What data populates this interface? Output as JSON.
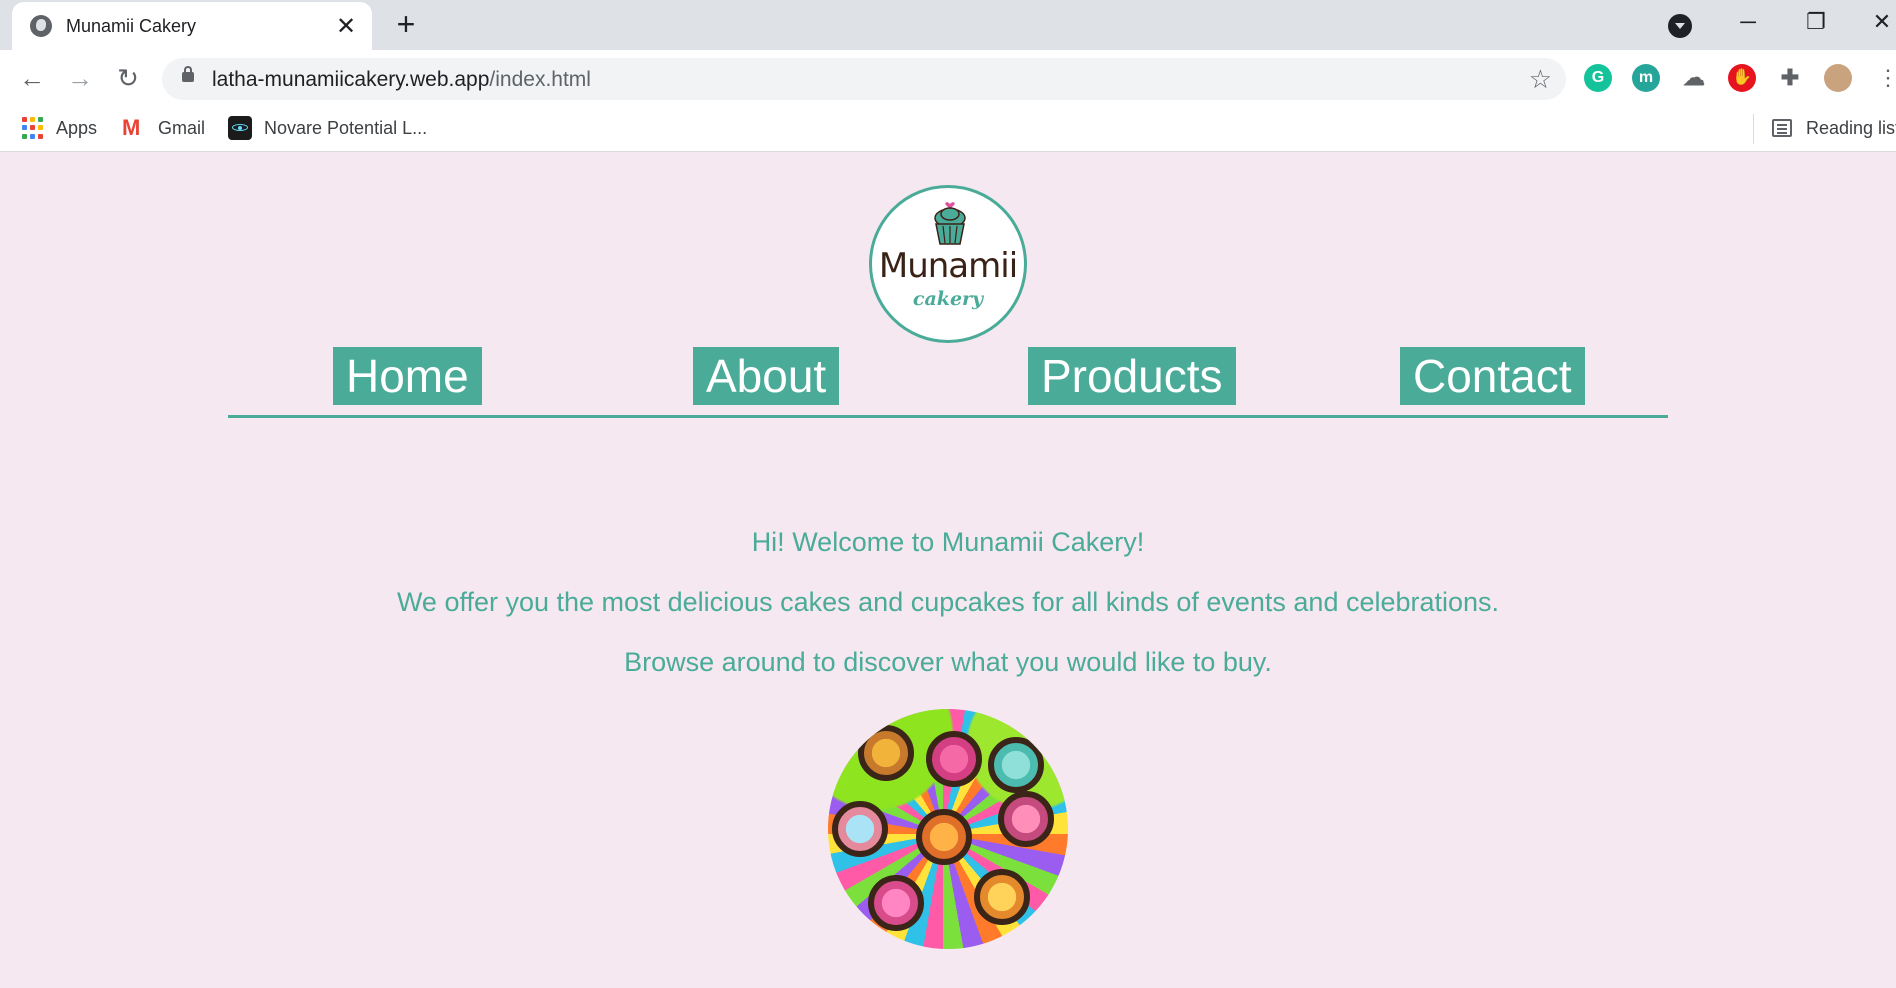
{
  "browser": {
    "tab_title": "Munamii Cakery",
    "url_host": "latha-munamiicakery.web.app",
    "url_path": "/index.html",
    "bookmarks": [
      {
        "label": "Apps",
        "icon": "apps-grid-icon"
      },
      {
        "label": "Gmail",
        "icon": "gmail-icon"
      },
      {
        "label": "Novare Potential L...",
        "icon": "react-icon"
      }
    ],
    "reading_list_label": "Reading list",
    "extensions": [
      {
        "icon": "grammarly-icon",
        "glyph": "G",
        "color": "#15c39a"
      },
      {
        "icon": "m-extension-icon",
        "glyph": "m",
        "color": "#26a69a"
      },
      {
        "icon": "cloud-extension-icon",
        "glyph": "☁",
        "color": "#5f6368"
      },
      {
        "icon": "adblock-icon",
        "glyph": "✋",
        "color": "#e6141f"
      },
      {
        "icon": "puzzle-icon",
        "glyph": "✚",
        "color": "#5f6368"
      }
    ]
  },
  "site": {
    "logo": {
      "name": "Munamii",
      "sub": "cakery"
    },
    "nav": [
      "Home",
      "About",
      "Products",
      "Contact"
    ],
    "intro": [
      "Hi! Welcome to Munamii Cakery!",
      "We offer you the most delicious cakes and cupcakes for all kinds of events and celebrations.",
      "Browse around to discover what you would like to buy."
    ],
    "image_alt_icon": "cupcakes-photo",
    "colors": {
      "accent": "#4aab98",
      "background": "#f6e8f1",
      "logo_text": "#3a2217"
    }
  }
}
